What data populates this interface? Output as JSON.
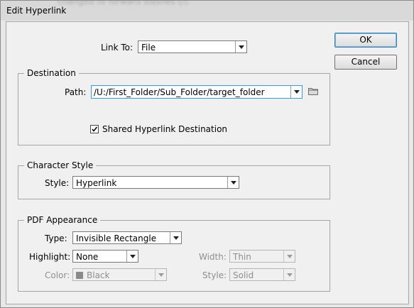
{
  "window": {
    "title": "Edit Hyperlink",
    "background_text": "... e ... ... ... ... ... ... ... ..."
  },
  "buttons": {
    "ok": "OK",
    "cancel": "Cancel"
  },
  "link_to": {
    "label": "Link To:",
    "value": "File"
  },
  "destination": {
    "title": "Destination",
    "path_label": "Path:",
    "path_value": "/U:/First_Folder/Sub_Folder/target_folder",
    "shared_label": "Shared Hyperlink Destination",
    "shared_checked": true
  },
  "character_style": {
    "title": "Character Style",
    "style_label": "Style:",
    "style_value": "Hyperlink"
  },
  "pdf_appearance": {
    "title": "PDF Appearance",
    "type_label": "Type:",
    "type_value": "Invisible Rectangle",
    "highlight_label": "Highlight:",
    "highlight_value": "None",
    "color_label": "Color:",
    "color_value": "Black",
    "width_label": "Width:",
    "width_value": "Thin",
    "style_label": "Style:",
    "style_value": "Solid"
  },
  "colors": {
    "focus_border": "#3399ff",
    "swatch": "#8a8a8a"
  }
}
